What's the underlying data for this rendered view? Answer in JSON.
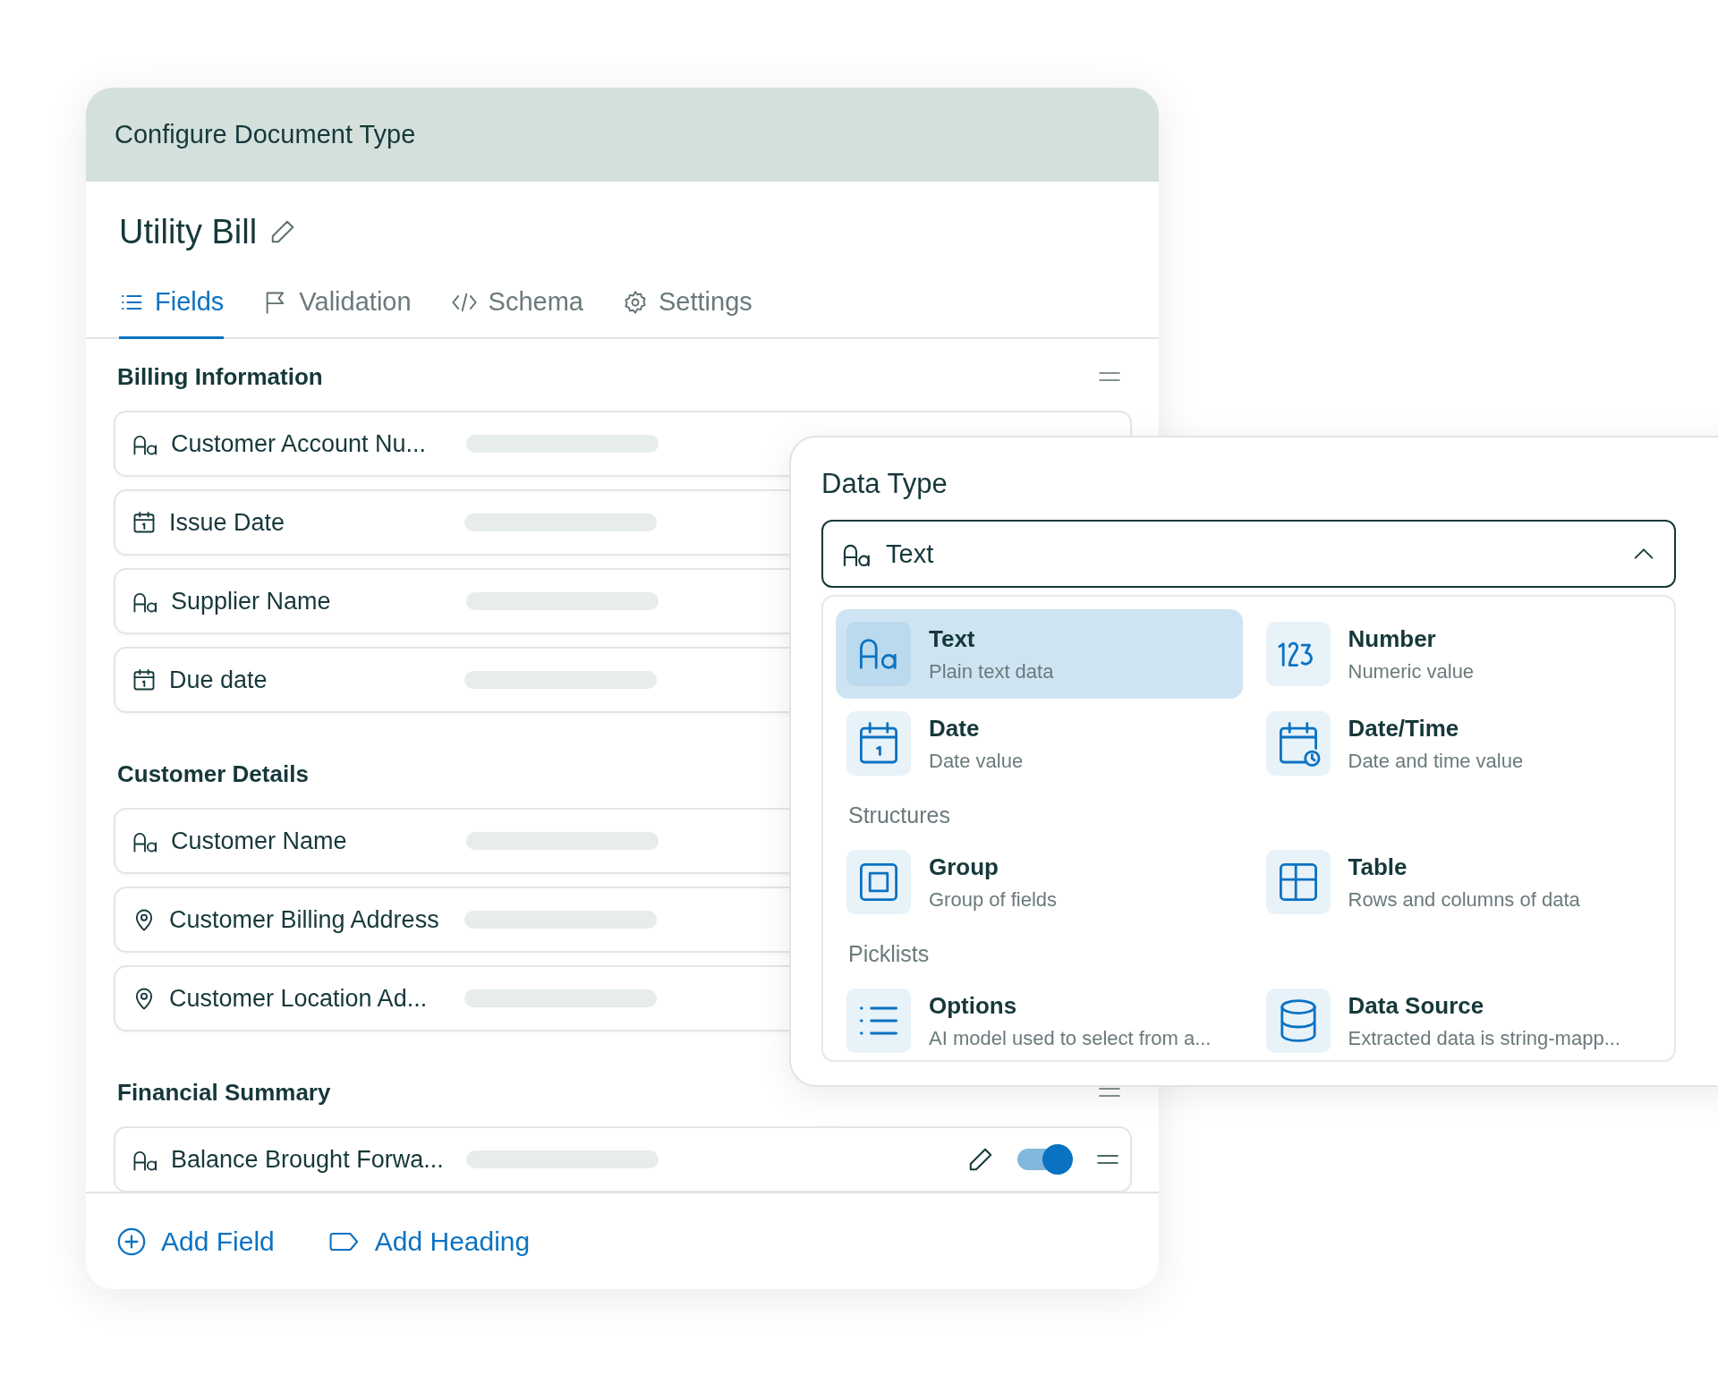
{
  "window": {
    "title": "Configure Document Type"
  },
  "document": {
    "name": "Utility Bill"
  },
  "tabs": [
    {
      "label": "Fields",
      "selected": true
    },
    {
      "label": "Validation",
      "selected": false
    },
    {
      "label": "Schema",
      "selected": false
    },
    {
      "label": "Settings",
      "selected": false
    }
  ],
  "sections": [
    {
      "title": "Billing Information",
      "fields": [
        {
          "name": "Customer Account Nu...",
          "kind": "text"
        },
        {
          "name": "Issue Date",
          "kind": "date"
        },
        {
          "name": "Supplier Name",
          "kind": "text"
        },
        {
          "name": "Due date",
          "kind": "date"
        }
      ]
    },
    {
      "title": "Customer Details",
      "fields": [
        {
          "name": "Customer Name",
          "kind": "text"
        },
        {
          "name": "Customer Billing Address",
          "kind": "location"
        },
        {
          "name": "Customer Location Ad...",
          "kind": "location"
        }
      ]
    },
    {
      "title": "Financial Summary",
      "fields": [
        {
          "name": "Balance Brought Forwa...",
          "kind": "text",
          "toggle": {
            "on": true
          }
        }
      ]
    }
  ],
  "footer": [
    "Add Field",
    "Add Heading"
  ],
  "data_type": {
    "label": "Data Type",
    "select": {
      "value": "Text",
      "expanded": true
    },
    "groups": [
      {
        "options": [
          {
            "title": "Text",
            "description": "Plain text data",
            "kind": "text",
            "selected": true
          },
          {
            "title": "Number",
            "description": "Numeric value",
            "kind": "number",
            "selected": false
          },
          {
            "title": "Date",
            "description": "Date value",
            "kind": "date",
            "selected": false
          },
          {
            "title": "Date/Time",
            "description": "Date and time value",
            "kind": "datetime",
            "selected": false
          }
        ]
      },
      {
        "heading": "Structures",
        "options": [
          {
            "title": "Group",
            "description": "Group of fields",
            "kind": "group",
            "selected": false
          },
          {
            "title": "Table",
            "description": "Rows and columns of data",
            "kind": "table",
            "selected": false
          }
        ]
      },
      {
        "heading": "Picklists",
        "options": [
          {
            "title": "Options",
            "description": "AI model used to select from a...",
            "kind": "options",
            "selected": false
          },
          {
            "title": "Data Source",
            "description": "Extracted data is string-mapp...",
            "kind": "database",
            "selected": false
          }
        ]
      }
    ]
  }
}
